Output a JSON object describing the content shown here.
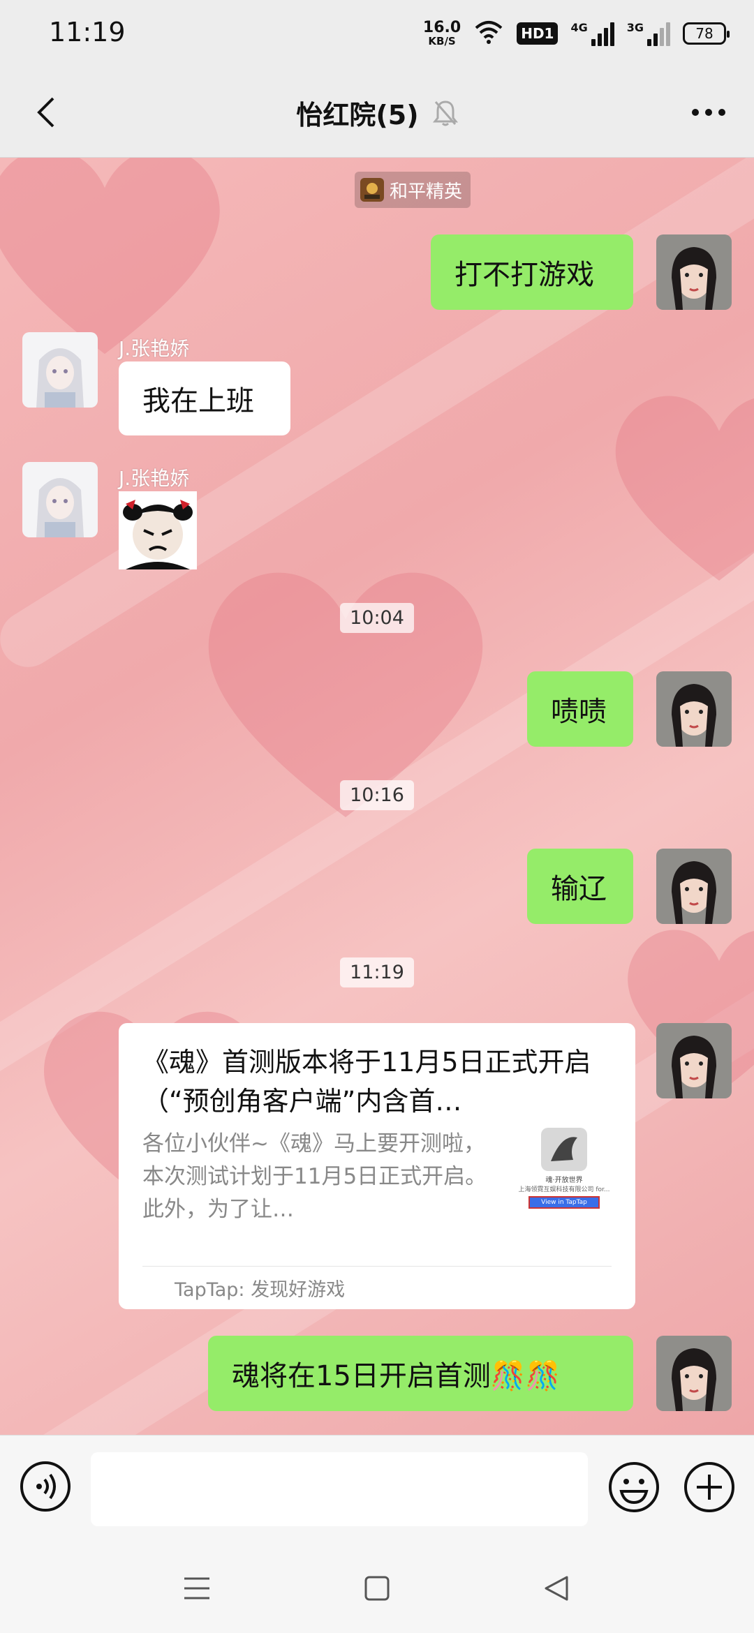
{
  "status_bar": {
    "time": "11:19",
    "net_speed": "16.0",
    "net_speed_unit": "KB/S",
    "hd_label": "HD1",
    "signal_1_label": "4G",
    "signal_2_label": "3G",
    "battery": "78"
  },
  "header": {
    "title": "怡红院(5)",
    "back_icon": "chevron-left-icon",
    "mute_icon": "bell-muted-icon",
    "more_icon": "more-dots-icon"
  },
  "chat": {
    "app_tag": "和平精英",
    "messages": [
      {
        "side": "right",
        "text": "打不打游戏"
      },
      {
        "side": "left",
        "sender": "J.张艳娇",
        "text": "我在上班"
      },
      {
        "side": "left",
        "sender": "J.张艳娇",
        "sticker": "angry-panda-sticker"
      },
      {
        "side": "right",
        "text": "啧啧"
      },
      {
        "side": "right",
        "text": "输辽"
      },
      {
        "side": "right",
        "text": "魂将在15日开启首测🎊🎊"
      }
    ],
    "timestamps": [
      "10:04",
      "10:16",
      "11:19"
    ],
    "link_card": {
      "title": "《魂》首测版本将于11月5日正式开启（“预创角客户端”内含首…",
      "description": "各位小伙伴~《魂》马上要开测啦，本次测试计划于11月5日正式开启。此外，为了让…",
      "thumb_caption_1": "魂·开放世界",
      "thumb_caption_2": "上海领霓互娱科技有限公司 for...",
      "thumb_button": "View in TapTap",
      "source": "TapTap: 发现好游戏"
    }
  },
  "input_bar": {
    "placeholder": "",
    "value": ""
  },
  "colors": {
    "bubble_green": "#95ec69",
    "chat_bg": "#f0a9ab"
  }
}
